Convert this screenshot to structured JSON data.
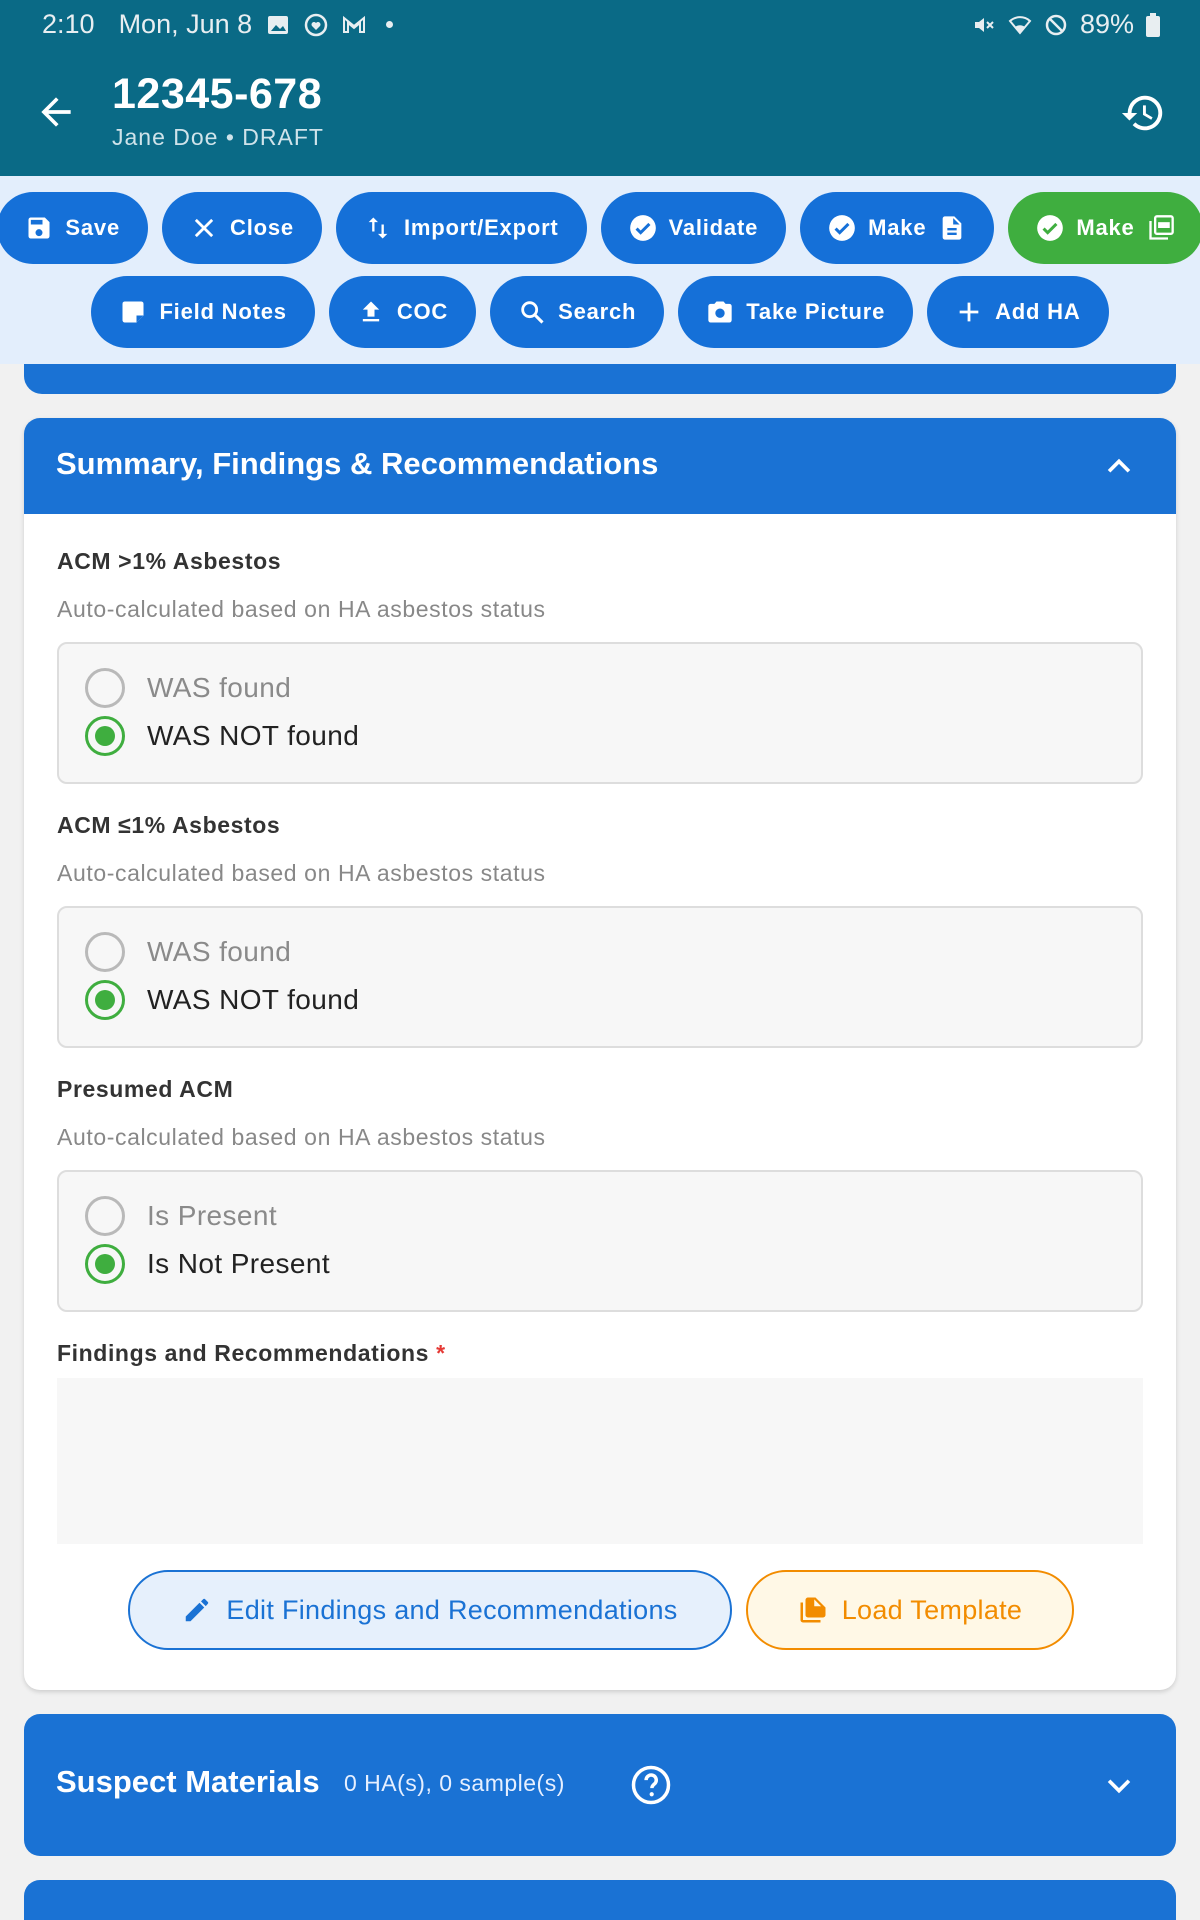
{
  "status_bar": {
    "time": "2:10",
    "date": "Mon, Jun 8",
    "battery": "89%"
  },
  "app_bar": {
    "title": "12345-678",
    "subtitle": "Jane Doe • DRAFT"
  },
  "toolbar": {
    "save": "Save",
    "close": "Close",
    "import_export": "Import/Export",
    "validate": "Validate",
    "make_doc": "Make",
    "make_pdf": "Make",
    "field_notes": "Field Notes",
    "coc": "COC",
    "search": "Search",
    "take_picture": "Take Picture",
    "add_ha": "Add HA"
  },
  "summary_card": {
    "title": "Summary, Findings & Recommendations",
    "acm_gt1": {
      "label": "ACM >1% Asbestos",
      "help": "Auto-calculated based on HA asbestos status",
      "option_1": "WAS found",
      "option_2": "WAS NOT found",
      "selected": "option_2"
    },
    "acm_le1": {
      "label": "ACM ≤1% Asbestos",
      "help": "Auto-calculated based on HA asbestos status",
      "option_1": "WAS found",
      "option_2": "WAS NOT found",
      "selected": "option_2"
    },
    "presumed": {
      "label": "Presumed ACM",
      "help": "Auto-calculated based on HA asbestos status",
      "option_1": "Is Present",
      "option_2": "Is Not Present",
      "selected": "option_2"
    },
    "findings": {
      "label": "Findings and Recommendations",
      "required_mark": "*",
      "value": ""
    },
    "edit_button": "Edit Findings and Recommendations",
    "load_template_button": "Load Template"
  },
  "suspect_materials": {
    "title": "Suspect Materials",
    "meta": "0 HA(s), 0 sample(s)"
  },
  "colors": {
    "app_bar": "#0a6a86",
    "primary": "#1a72d4",
    "success": "#3fae3f",
    "warning": "#f28c00",
    "required": "#e53935"
  }
}
